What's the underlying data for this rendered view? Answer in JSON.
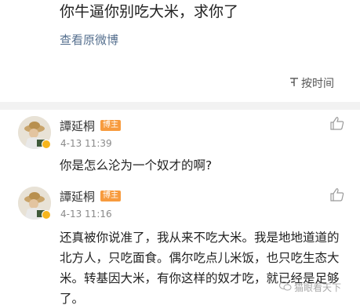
{
  "post": {
    "text": "你牛逼你别吃大米，求你了",
    "view_original_label": "查看原微博"
  },
  "sort": {
    "label": "按时间",
    "icon": "sort-icon"
  },
  "comments": [
    {
      "username": "譚延桐",
      "badge": "博主",
      "timestamp": "4-13 11:39",
      "text": "你是怎么沦为一个奴才的啊?"
    },
    {
      "username": "譚延桐",
      "badge": "博主",
      "timestamp": "4-13 11:16",
      "text_lines": [
        "还真被你说准了，我从来不吃大米。我是地地道道的",
        "北方人，只吃面食。偶尔吃点儿米饭，也只吃生态大",
        "米。转基因大米，有你这样的奴才吃，就已经是足够",
        "了。"
      ]
    }
  ],
  "watermark": {
    "text": "猫眼看天下"
  },
  "colors": {
    "badge": "#f79b3e",
    "verified": "#f6b51d",
    "link": "#56708f",
    "divider": "#f2f2f2"
  }
}
